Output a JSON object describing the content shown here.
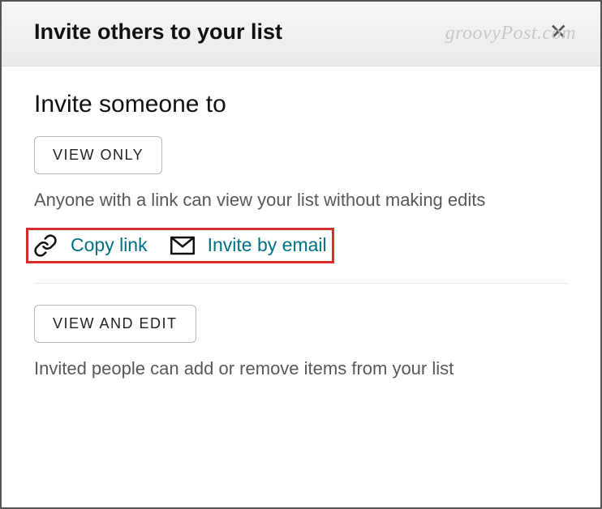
{
  "watermark": "groovyPost.com",
  "header": {
    "title": "Invite others to your list"
  },
  "main": {
    "section_title": "Invite someone to",
    "view_only": {
      "button_label": "VIEW ONLY",
      "description": "Anyone with a link can view your list without making edits",
      "actions": {
        "copy_link_label": "Copy link",
        "invite_email_label": "Invite by email"
      }
    },
    "view_edit": {
      "button_label": "VIEW AND EDIT",
      "description": "Invited people can add or remove items from your list"
    }
  }
}
